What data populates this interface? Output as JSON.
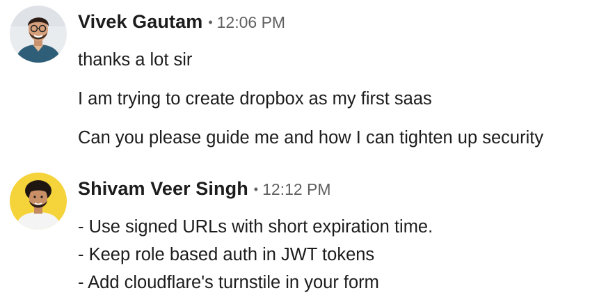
{
  "messages": [
    {
      "author": "Vivek Gautam",
      "separator": "•",
      "time": "12:06 PM",
      "avatar_icon": "user-photo-avatar",
      "lines": [
        "thanks a lot sir",
        "I am trying to create dropbox as my first saas",
        "Can you please guide me and how I can tighten up security"
      ]
    },
    {
      "author": "Shivam Veer Singh",
      "separator": "•",
      "time": "12:12 PM",
      "avatar_icon": "user-photo-avatar",
      "lines": [
        "- Use signed URLs with short expiration time.",
        "- Keep role based auth in JWT tokens",
        "- Add cloudflare's turnstile in your form"
      ]
    }
  ],
  "colors": {
    "text": "#1d1c1d",
    "muted": "#616061",
    "avatar1_bg": "#e9ecef",
    "avatar2_bg": "#f5d33a"
  }
}
